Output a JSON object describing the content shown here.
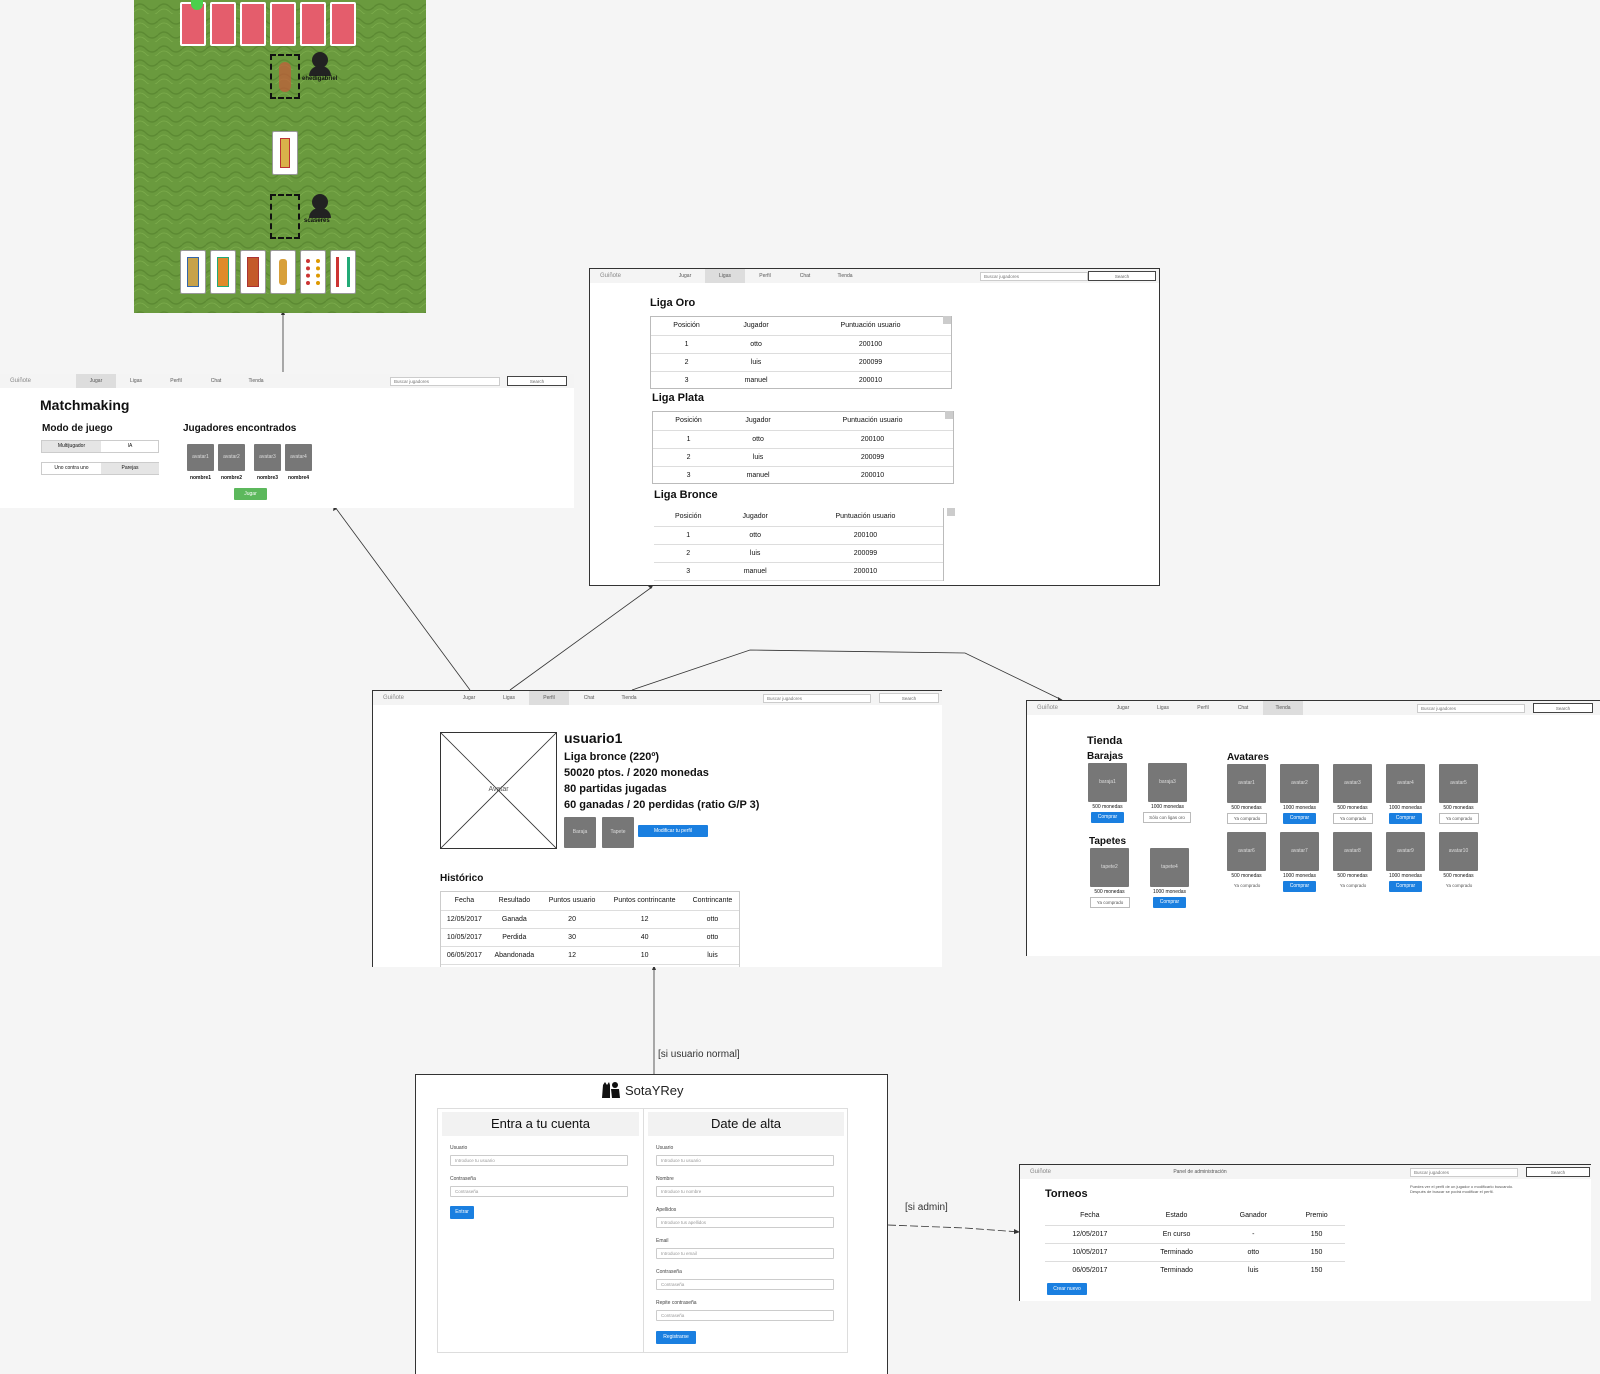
{
  "game_board": {
    "player_top": "ehedigabriel",
    "player_bottom": "scaseres"
  },
  "nav_common": {
    "brand": "Guiñote",
    "items": [
      "Jugar",
      "Ligas",
      "Perfil",
      "Chat",
      "Tienda"
    ],
    "search_placeholder": "Buscar jugadores",
    "search_button": "Search"
  },
  "matchmaking": {
    "title": "Matchmaking",
    "mode_title": "Modo de juego",
    "mode_options": [
      "Multijugador",
      "IA",
      "Uno contra uno",
      "Parejas"
    ],
    "players_title": "Jugadores encontrados",
    "avatars": [
      "avatar1",
      "avatar2",
      "avatar3",
      "avatar4"
    ],
    "names": [
      "nombre1",
      "nombre2",
      "nombre3",
      "nombre4"
    ],
    "play_button": "Jugar"
  },
  "ligas": {
    "leagues": [
      {
        "title": "Liga Oro",
        "headers": [
          "Posición",
          "Jugador",
          "Puntuación usuario"
        ],
        "rows": [
          [
            "1",
            "otto",
            "200100"
          ],
          [
            "2",
            "luis",
            "200099"
          ],
          [
            "3",
            "manuel",
            "200010"
          ]
        ]
      },
      {
        "title": "Liga Plata",
        "headers": [
          "Posición",
          "Jugador",
          "Puntuación usuario"
        ],
        "rows": [
          [
            "1",
            "otto",
            "200100"
          ],
          [
            "2",
            "luis",
            "200099"
          ],
          [
            "3",
            "manuel",
            "200010"
          ]
        ]
      },
      {
        "title": "Liga Bronce",
        "headers": [
          "Posición",
          "Jugador",
          "Puntuación usuario"
        ],
        "rows": [
          [
            "1",
            "otto",
            "200100"
          ],
          [
            "2",
            "luis",
            "200099"
          ],
          [
            "3",
            "manuel",
            "200010"
          ]
        ]
      }
    ]
  },
  "perfil": {
    "avatar_label": "Avatar",
    "username": "usuario1",
    "league": "Liga bronce (220º)",
    "points": "50020 ptos. / 2020 monedas",
    "played": "80 partidas jugadas",
    "record": "60 ganadas / 20 perdidas (ratio G/P 3)",
    "baraja_label": "Baraja",
    "tapete_label": "Tapete",
    "edit_button": "Modificar tu perfil",
    "history_title": "Histórico",
    "history_headers": [
      "Fecha",
      "Resultado",
      "Puntos usuario",
      "Puntos contrincante",
      "Contrincante"
    ],
    "history_rows": [
      [
        "12/05/2017",
        "Ganada",
        "20",
        "12",
        "otto"
      ],
      [
        "10/05/2017",
        "Perdida",
        "30",
        "40",
        "otto"
      ],
      [
        "06/05/2017",
        "Abandonada",
        "12",
        "10",
        "luis"
      ]
    ]
  },
  "tienda": {
    "title": "Tienda",
    "barajas_title": "Barajas",
    "tapetes_title": "Tapetes",
    "avatares_title": "Avatares",
    "barajas": [
      {
        "name": "baraja1",
        "price": "500 monedas",
        "action": "Comprar"
      },
      {
        "name": "baraja3",
        "price": "1000 monedas",
        "action": "Sólo con ligas oro"
      }
    ],
    "tapetes": [
      {
        "name": "tapete2",
        "price": "500 monedas",
        "action": "Ya comprado"
      },
      {
        "name": "tapete4",
        "price": "1000 monedas",
        "action": "Comprar"
      }
    ],
    "avatares": [
      {
        "name": "avatar1",
        "price": "500 monedas",
        "action": "Ya comprado"
      },
      {
        "name": "avatar2",
        "price": "1000 monedas",
        "action": "Comprar"
      },
      {
        "name": "avatar3",
        "price": "500 monedas",
        "action": "Ya comprado"
      },
      {
        "name": "avatar4",
        "price": "1000 monedas",
        "action": "Comprar"
      },
      {
        "name": "avatar5",
        "price": "500 monedas",
        "action": "Ya comprado"
      },
      {
        "name": "avatar6",
        "price": "500 monedas",
        "action": "Ya comprado"
      },
      {
        "name": "avatar7",
        "price": "1000 monedas",
        "action": "Comprar"
      },
      {
        "name": "avatar8",
        "price": "500 monedas",
        "action": "Ya comprado"
      },
      {
        "name": "avatar9",
        "price": "1000 monedas",
        "action": "Comprar"
      },
      {
        "name": "avatar10",
        "price": "500 monedas",
        "action": "Ya comprado"
      }
    ]
  },
  "login": {
    "brand": "SotaYRey",
    "login_title": "Entra a tu cuenta",
    "signup_title": "Date de alta",
    "login_fields": [
      {
        "label": "Usuario",
        "placeholder": "Introduce tu usuario"
      },
      {
        "label": "Contraseña",
        "placeholder": "Contraseña"
      }
    ],
    "login_button": "Entrar",
    "signup_fields": [
      {
        "label": "Usuario",
        "placeholder": "Introduce tu usuario"
      },
      {
        "label": "Nombre",
        "placeholder": "Introduce tu nombre"
      },
      {
        "label": "Apellidos",
        "placeholder": "Introduce tus apellidos"
      },
      {
        "label": "Email",
        "placeholder": "Introduce tu email"
      },
      {
        "label": "Contraseña",
        "placeholder": "Contraseña"
      },
      {
        "label": "Repite contraseña",
        "placeholder": "Contraseña"
      }
    ],
    "signup_button": "Registrarse"
  },
  "edge_labels": {
    "normal_user": "[si usuario normal]",
    "admin": "[si admin]"
  },
  "admin": {
    "nav_center": "Panel de administración",
    "search_placeholder": "Buscar jugadores",
    "search_button": "Search",
    "note": "Puedes ver el perfil de un jugador o modificarlo buscando. Después de buscar se podrá modificar el perfil.",
    "title": "Torneos",
    "headers": [
      "Fecha",
      "Estado",
      "Ganador",
      "Premio"
    ],
    "rows": [
      [
        "12/05/2017",
        "En curso",
        "-",
        "150"
      ],
      [
        "10/05/2017",
        "Terminado",
        "otto",
        "150"
      ],
      [
        "06/05/2017",
        "Terminado",
        "luis",
        "150"
      ]
    ],
    "new_button": "Crear nuevo"
  }
}
